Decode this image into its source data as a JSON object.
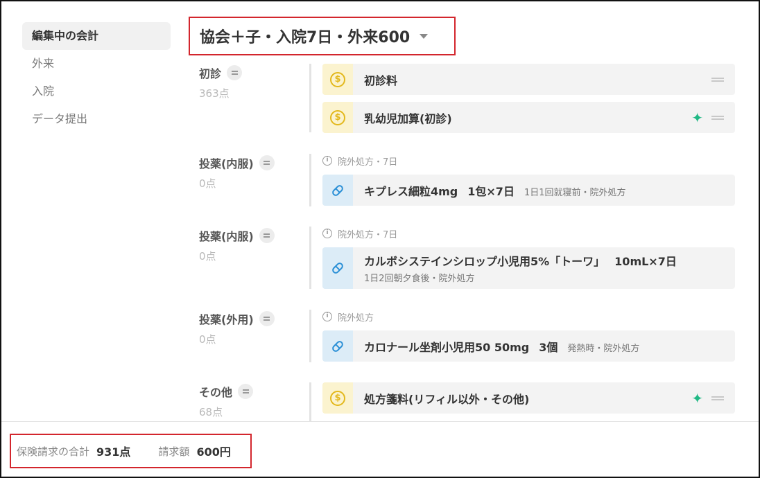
{
  "sidebar": {
    "items": [
      {
        "label": "編集中の会計"
      },
      {
        "label": "外来"
      },
      {
        "label": "入院"
      },
      {
        "label": "データ提出"
      }
    ]
  },
  "header": {
    "title": "協会＋子・入院7日・外来600"
  },
  "groups": [
    {
      "name": "初診",
      "points": "363点",
      "items": [
        {
          "icon": "coin-icon",
          "name": "初診料"
        },
        {
          "icon": "coin-icon",
          "name": "乳幼児加算(初診)"
        }
      ]
    },
    {
      "name": "投薬(内服)",
      "points": "0点",
      "note": "院外処方・7日",
      "items": [
        {
          "icon": "pill-icon",
          "name": "キプレス細粒4mg",
          "qty": "1包×7日",
          "detail": "1日1回就寝前・院外処方"
        }
      ]
    },
    {
      "name": "投薬(内服)",
      "points": "0点",
      "note": "院外処方・7日",
      "items": [
        {
          "icon": "pill-icon",
          "name": "カルボシステインシロップ小児用5%「トーワ」",
          "qty": "10mL×7日",
          "sub": "1日2回朝夕食後・院外処方"
        }
      ]
    },
    {
      "name": "投薬(外用)",
      "points": "0点",
      "note": "院外処方",
      "items": [
        {
          "icon": "pill-icon",
          "name": "カロナール坐剤小児用50 50mg",
          "qty": "3個",
          "detail": "発熱時・院外処方"
        }
      ]
    },
    {
      "name": "その他",
      "points": "68点",
      "items": [
        {
          "icon": "coin-icon",
          "name": "処方箋料(リフィル以外・その他)"
        }
      ]
    }
  ],
  "footer": {
    "insurance_label": "保険請求の合計",
    "insurance_value": "931点",
    "billing_label": "請求額",
    "billing_value": "600円"
  },
  "colors": {
    "accent_red": "#d3262d",
    "sparkle_green": "#1fb884",
    "coin_yellow": "#e3b81c",
    "pill_blue": "#2a8fd6"
  }
}
